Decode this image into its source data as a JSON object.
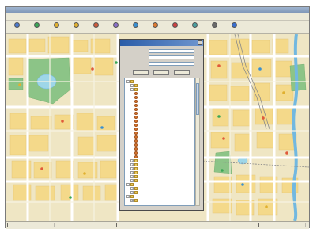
{
  "window": {
    "title": ""
  },
  "menus": [
    "",
    "",
    "",
    "",
    "",
    ""
  ],
  "toolbar": {
    "buttons": [
      {
        "label": "",
        "icon": "open-icon",
        "color": "#4b7ad0"
      },
      {
        "label": "",
        "icon": "globe-icon",
        "color": "#3aa655"
      },
      {
        "label": "",
        "icon": "zoom-in-icon",
        "color": "#e0b030"
      },
      {
        "label": "",
        "icon": "zoom-out-icon",
        "color": "#e0b030"
      },
      {
        "label": "",
        "icon": "pan-icon",
        "color": "#d05a3a"
      },
      {
        "label": "",
        "icon": "measure-icon",
        "color": "#8a6fc9"
      },
      {
        "label": "",
        "icon": "search-icon",
        "color": "#3a8fd0"
      },
      {
        "label": "",
        "icon": "layer-icon",
        "color": "#e07a30"
      },
      {
        "label": "",
        "icon": "bus-icon",
        "color": "#d04040"
      },
      {
        "label": "",
        "icon": "route-icon",
        "color": "#4aa0a0"
      },
      {
        "label": "",
        "icon": "print-icon",
        "color": "#6a6a6a"
      },
      {
        "label": "",
        "icon": "help-icon",
        "color": "#3a6fd0"
      }
    ]
  },
  "map": {
    "labels": [
      "",
      "",
      "",
      "",
      "",
      ""
    ],
    "colors": {
      "land": "#efe6c4",
      "block": "#f4d98a",
      "park": "#8cc487",
      "water": "#9ed6e8",
      "road": "#ffffff",
      "river": "#72b8e0"
    }
  },
  "dialog": {
    "title": "",
    "fields": [
      {
        "label": "",
        "value": ""
      },
      {
        "label": "",
        "value": ""
      },
      {
        "label": "",
        "value": ""
      }
    ],
    "buttons": [
      "",
      "",
      ""
    ],
    "tree": [
      {
        "label": "",
        "level": 0,
        "box": "-",
        "icon": "folder-icon"
      },
      {
        "label": "",
        "level": 1,
        "box": "-",
        "icon": "folder-icon"
      },
      {
        "label": "",
        "level": 1,
        "box": "-",
        "icon": "folder-icon"
      },
      {
        "label": "",
        "level": 2,
        "box": "",
        "icon": "poi-icon"
      },
      {
        "label": "",
        "level": 2,
        "box": "",
        "icon": "poi-icon"
      },
      {
        "label": "",
        "level": 2,
        "box": "",
        "icon": "poi-icon"
      },
      {
        "label": "",
        "level": 2,
        "box": "",
        "icon": "poi-icon"
      },
      {
        "label": "",
        "level": 2,
        "box": "",
        "icon": "poi-icon"
      },
      {
        "label": "",
        "level": 2,
        "box": "",
        "icon": "poi-icon"
      },
      {
        "label": "",
        "level": 2,
        "box": "",
        "icon": "poi-icon"
      },
      {
        "label": "",
        "level": 2,
        "box": "",
        "icon": "poi-icon"
      },
      {
        "label": "",
        "level": 2,
        "box": "",
        "icon": "poi-icon"
      },
      {
        "label": "",
        "level": 2,
        "box": "",
        "icon": "poi-icon"
      },
      {
        "label": "",
        "level": 2,
        "box": "",
        "icon": "poi-icon"
      },
      {
        "label": "",
        "level": 2,
        "box": "",
        "icon": "poi-icon"
      },
      {
        "label": "",
        "level": 2,
        "box": "",
        "icon": "poi-icon"
      },
      {
        "label": "",
        "level": 2,
        "box": "",
        "icon": "poi-icon"
      },
      {
        "label": "",
        "level": 2,
        "box": "",
        "icon": "poi-icon"
      },
      {
        "label": "",
        "level": 2,
        "box": "",
        "icon": "poi-icon"
      },
      {
        "label": "",
        "level": 2,
        "box": "",
        "icon": "poi-icon"
      },
      {
        "label": "",
        "level": 1,
        "box": "+",
        "icon": "folder-icon"
      },
      {
        "label": "",
        "level": 1,
        "box": "+",
        "icon": "folder-icon"
      },
      {
        "label": "",
        "level": 1,
        "box": "+",
        "icon": "folder-icon"
      },
      {
        "label": "",
        "level": 1,
        "box": "+",
        "icon": "folder-icon"
      },
      {
        "label": "",
        "level": 1,
        "box": "+",
        "icon": "folder-icon"
      },
      {
        "label": "",
        "level": 1,
        "box": "+",
        "icon": "folder-icon"
      },
      {
        "label": "",
        "level": 0,
        "box": "-",
        "icon": "folder-icon"
      },
      {
        "label": "",
        "level": 1,
        "box": "+",
        "icon": "folder-icon"
      },
      {
        "label": "",
        "level": 1,
        "box": "+",
        "icon": "folder-icon"
      },
      {
        "label": "",
        "level": 0,
        "box": "+",
        "icon": "folder-icon"
      },
      {
        "label": "",
        "level": 1,
        "box": "+",
        "icon": "folder-icon"
      }
    ]
  },
  "status": {
    "cells": [
      "",
      "",
      ""
    ]
  }
}
